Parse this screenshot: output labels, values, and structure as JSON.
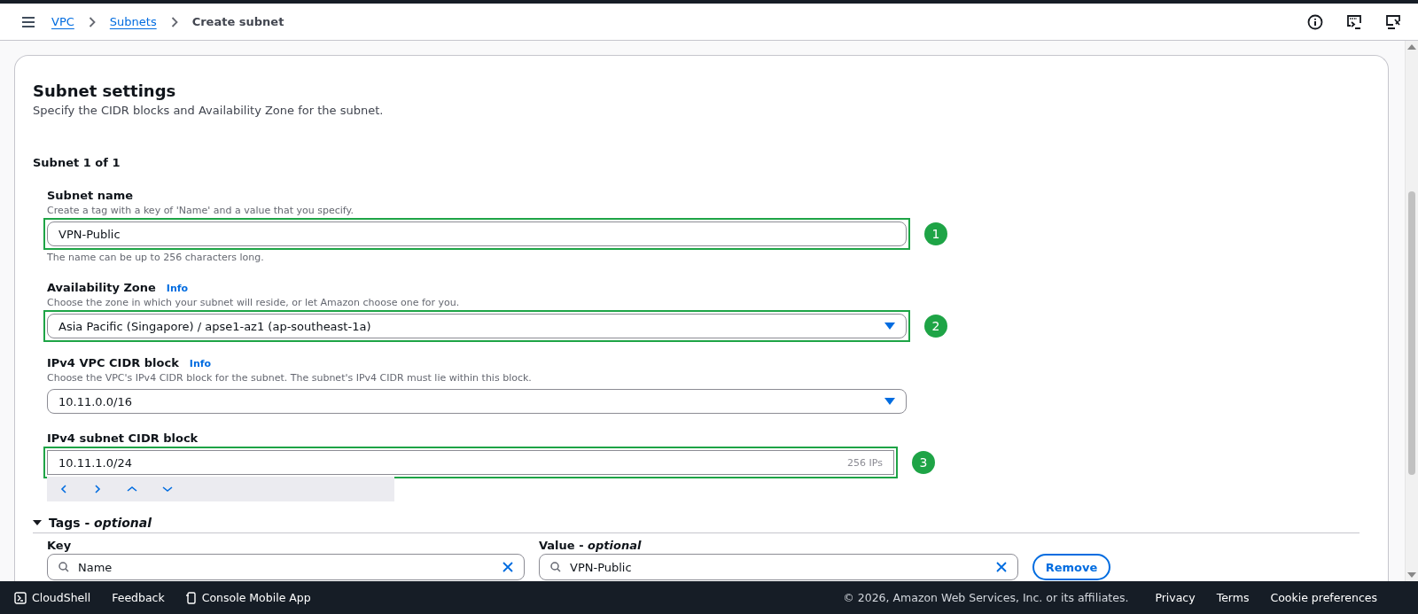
{
  "header": {
    "breadcrumbs": [
      {
        "label": "VPC",
        "link": true
      },
      {
        "label": "Subnets",
        "link": true
      },
      {
        "label": "Create subnet",
        "link": false
      }
    ]
  },
  "section": {
    "title": "Subnet settings",
    "description": "Specify the CIDR blocks and Availability Zone for the subnet.",
    "subheading": "Subnet 1 of 1"
  },
  "fields": [
    {
      "kind": "text",
      "label": "Subnet name",
      "description": "Create a tag with a key of 'Name' and a value that you specify.",
      "value": "VPN-Public",
      "hint": "The name can be up to 256 characters long.",
      "marker": "1"
    },
    {
      "kind": "select",
      "label": "Availability Zone",
      "info": "Info",
      "description": "Choose the zone in which your subnet will reside, or let Amazon choose one for you.",
      "value": "Asia Pacific (Singapore) / apse1-az1 (ap-southeast-1a)",
      "marker": "2"
    },
    {
      "kind": "select",
      "label": "IPv4 VPC CIDR block",
      "info": "Info",
      "description": "Choose the VPC's IPv4 CIDR block for the subnet. The subnet's IPv4 CIDR must lie within this block.",
      "value": "10.11.0.0/16"
    },
    {
      "kind": "cidr",
      "label": "IPv4 subnet CIDR block",
      "value": "10.11.1.0/24",
      "suffix": "256 IPs",
      "marker": "3"
    }
  ],
  "tags": {
    "title": "Tags - ",
    "title_emphasis": "optional",
    "expanded": true,
    "key_label": "Key",
    "value_label": "Value - ",
    "value_label_emphasis": "optional",
    "rows": [
      {
        "key": "Name",
        "value": "VPN-Public",
        "remove": "Remove"
      }
    ]
  },
  "footer": {
    "left": [
      "CloudShell",
      "Feedback",
      "Console Mobile App"
    ],
    "copyright": "© 2026, Amazon Web Services, Inc. or its affiliates.",
    "links": [
      "Privacy",
      "Terms",
      "Cookie preferences"
    ]
  }
}
